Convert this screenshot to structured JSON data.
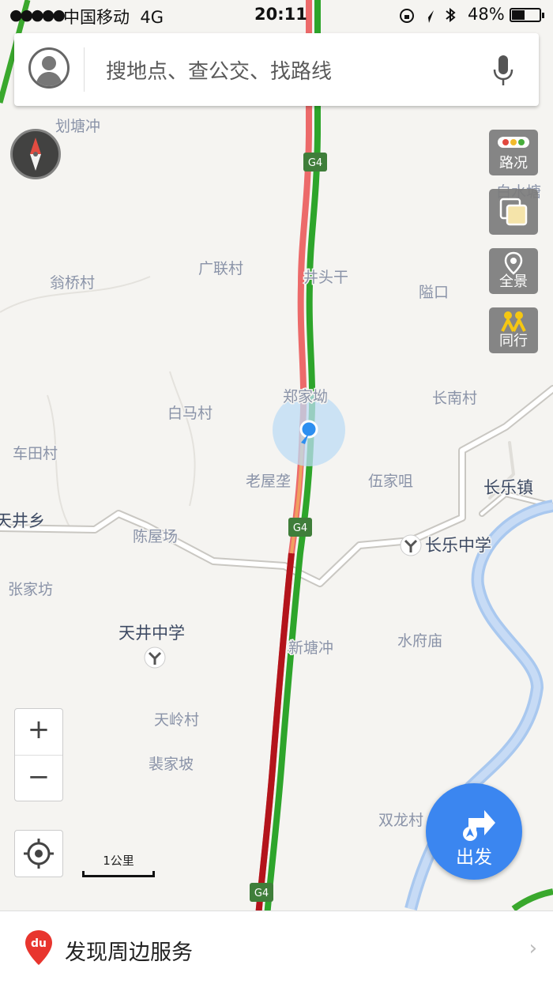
{
  "status_bar": {
    "signal": "●●●●●",
    "carrier": "中国移动",
    "network": "4G",
    "time": "20:11",
    "battery_percent": "48%",
    "battery_level": 0.48
  },
  "search": {
    "placeholder": "搜地点、查公交、找路线"
  },
  "side_buttons": [
    {
      "label": "路况",
      "icon": "traffic-light-icon"
    },
    {
      "label": "",
      "icon": "layers-icon"
    },
    {
      "label": "全景",
      "icon": "panorama-pin-icon"
    },
    {
      "label": "同行",
      "icon": "companions-icon"
    }
  ],
  "map": {
    "road_shields": [
      "G4",
      "G4",
      "G4"
    ],
    "places": [
      {
        "name": "划塘冲",
        "kind": "village"
      },
      {
        "name": "白水塘",
        "kind": "village"
      },
      {
        "name": "广联村",
        "kind": "village"
      },
      {
        "name": "翁桥村",
        "kind": "village"
      },
      {
        "name": "井头干",
        "kind": "village"
      },
      {
        "name": "隘口",
        "kind": "village"
      },
      {
        "name": "郑家坳",
        "kind": "village"
      },
      {
        "name": "长南村",
        "kind": "village"
      },
      {
        "name": "白马村",
        "kind": "village"
      },
      {
        "name": "车田村",
        "kind": "village"
      },
      {
        "name": "老屋垄",
        "kind": "village"
      },
      {
        "name": "伍家咀",
        "kind": "village"
      },
      {
        "name": "长乐镇",
        "kind": "town"
      },
      {
        "name": "天井乡",
        "kind": "town"
      },
      {
        "name": "陈屋场",
        "kind": "village"
      },
      {
        "name": "长乐中学",
        "kind": "school"
      },
      {
        "name": "张家坊",
        "kind": "village"
      },
      {
        "name": "天井中学",
        "kind": "school"
      },
      {
        "name": "新塘冲",
        "kind": "village"
      },
      {
        "name": "水府庙",
        "kind": "village"
      },
      {
        "name": "天岭村",
        "kind": "village"
      },
      {
        "name": "裴家坡",
        "kind": "village"
      },
      {
        "name": "双龙村",
        "kind": "village"
      }
    ]
  },
  "controls": {
    "zoom_in": "+",
    "zoom_out": "−",
    "scale_label": "1公里"
  },
  "go_button": {
    "label": "出发"
  },
  "bottom_bar": {
    "label": "发现周边服务",
    "logo": "du",
    "chevron": "›"
  }
}
